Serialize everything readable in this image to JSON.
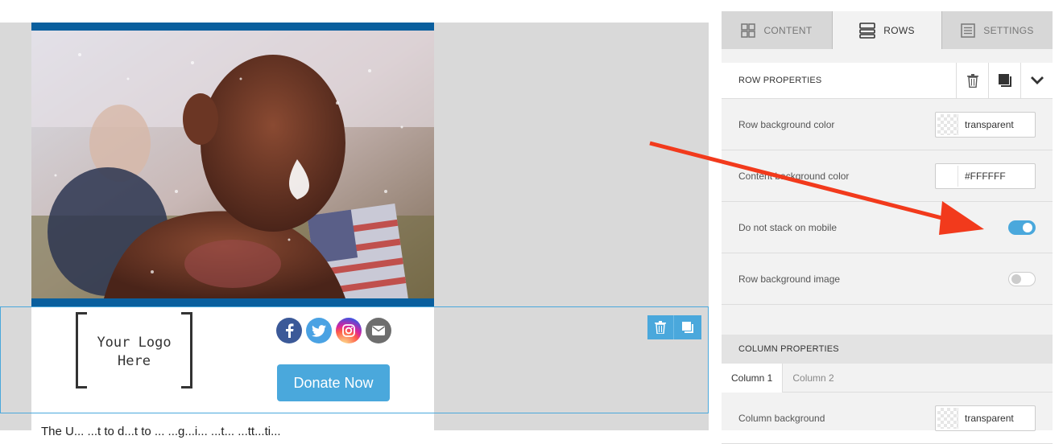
{
  "email": {
    "logo_text_line1": "Your Logo",
    "logo_text_line2": "Here",
    "donate_label": "Donate Now",
    "body_text": "The U...  ...t to d...t to ...  ...g...i...  ...t...  ...tt...ti...",
    "social_icons": [
      "facebook-icon",
      "twitter-icon",
      "instagram-icon",
      "email-icon"
    ]
  },
  "panel": {
    "tabs": [
      {
        "label": "CONTENT",
        "icon": "grid-icon",
        "active": false
      },
      {
        "label": "ROWS",
        "icon": "rows-icon",
        "active": true
      },
      {
        "label": "SETTINGS",
        "icon": "settings-list-icon",
        "active": false
      }
    ],
    "row_properties": {
      "title": "ROW PROPERTIES",
      "row_bg_label": "Row background color",
      "row_bg_value": "transparent",
      "content_bg_label": "Content background color",
      "content_bg_value": "#FFFFFF",
      "no_stack_label": "Do not stack on mobile",
      "no_stack_on": true,
      "row_bg_image_label": "Row background image",
      "row_bg_image_on": false
    },
    "column_properties": {
      "title": "COLUMN PROPERTIES",
      "tabs": [
        "Column 1",
        "Column 2"
      ],
      "active_tab": "Column 1",
      "col_bg_label": "Column background",
      "col_bg_value": "transparent"
    }
  },
  "colors": {
    "accent": "#4aa8dc",
    "hero_frame": "#0a5f9e",
    "arrow": "#f23a1c",
    "facebook": "#3b5998",
    "twitter": "#4aa2e3",
    "instagram": "#c13584",
    "email": "#6e6e6e"
  }
}
